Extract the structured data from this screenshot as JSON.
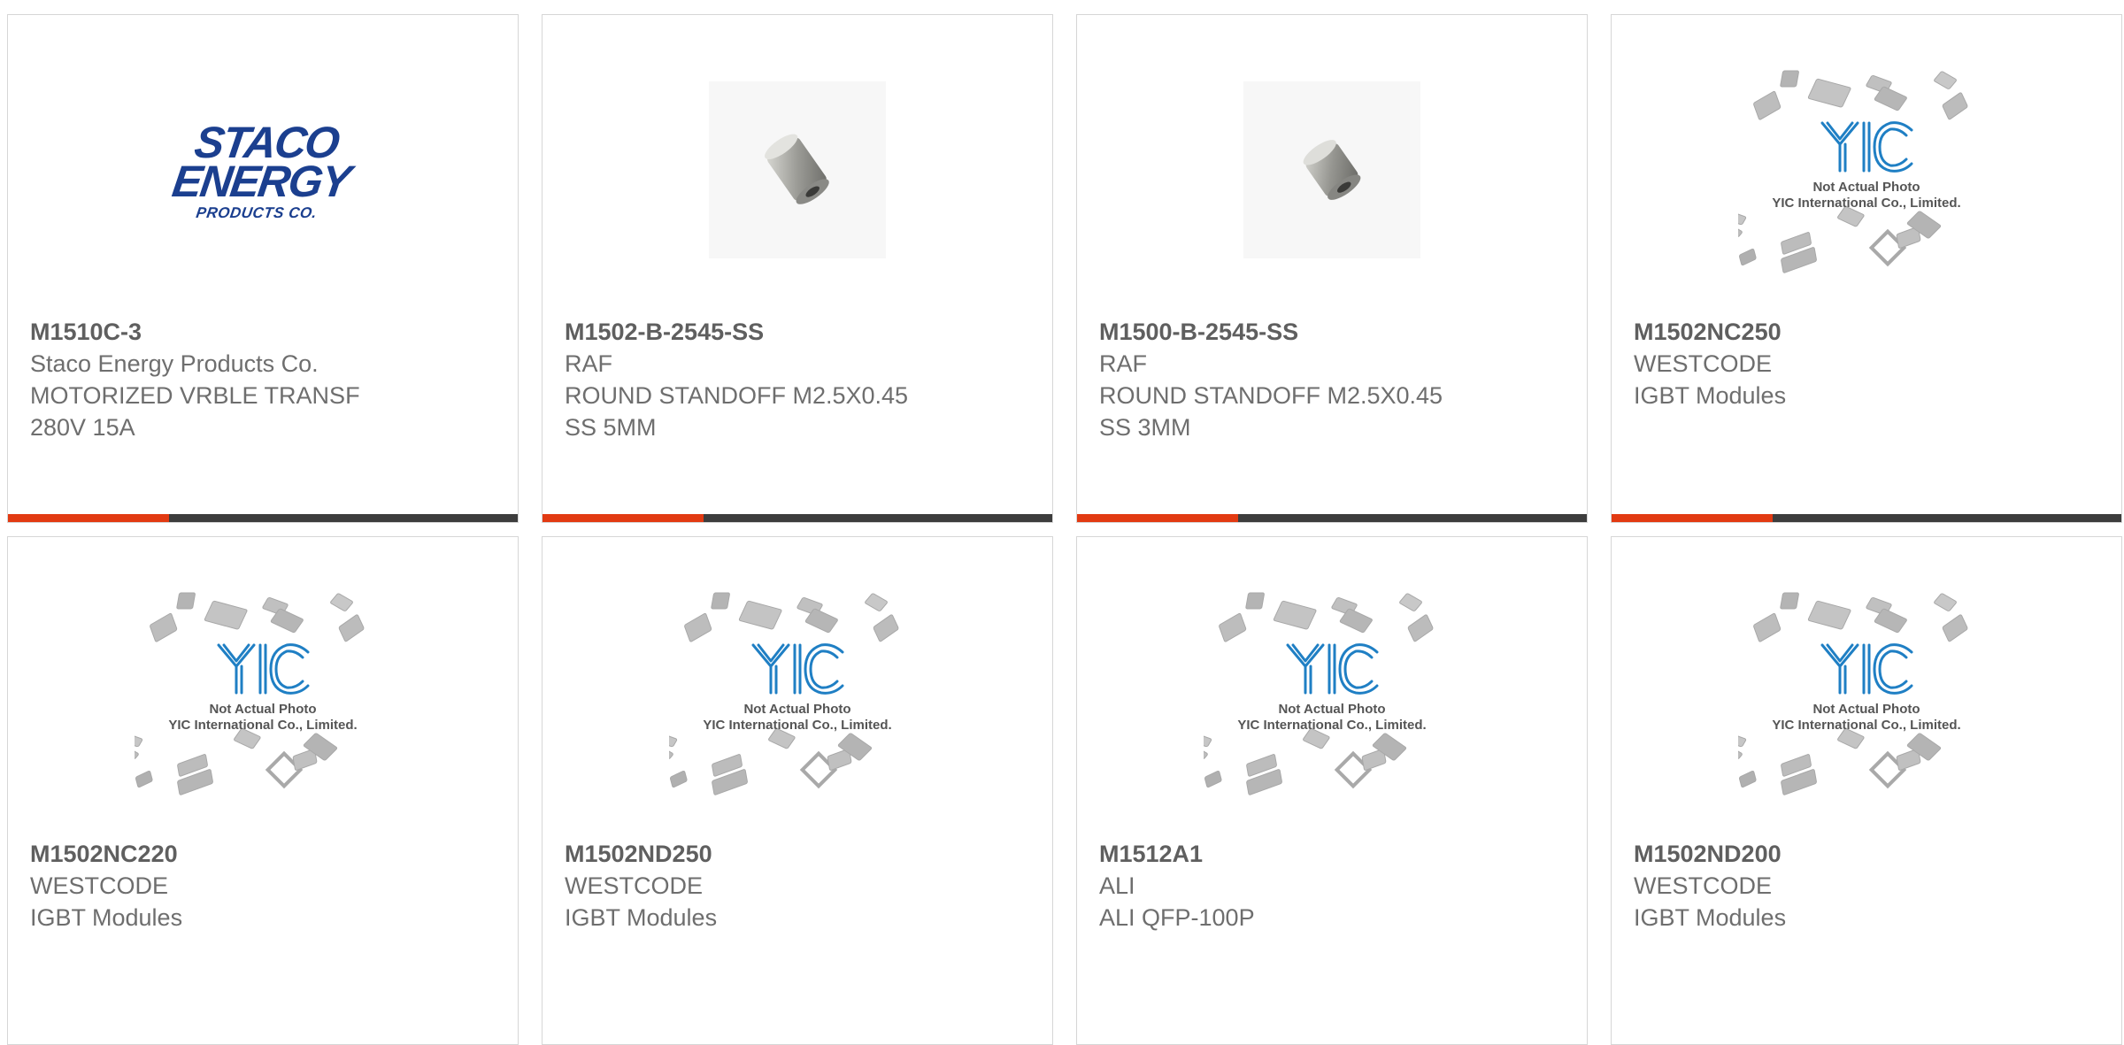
{
  "products": [
    {
      "part": "M1510C-3",
      "lines": [
        "Staco Energy Products Co.",
        "MOTORIZED VRBLE TRANSF",
        "280V 15A"
      ],
      "image": "staco-logo",
      "logo": {
        "w1": "STACO",
        "w2": "ENERGY",
        "w3": "PRODUCTS CO."
      }
    },
    {
      "part": "M1502-B-2545-SS",
      "lines": [
        "RAF",
        "ROUND STANDOFF M2.5X0.45",
        "SS 5MM"
      ],
      "image": "standoff-photo"
    },
    {
      "part": "M1500-B-2545-SS",
      "lines": [
        "RAF",
        "ROUND STANDOFF M2.5X0.45",
        "SS 3MM"
      ],
      "image": "standoff-photo"
    },
    {
      "part": "M1502NC250",
      "lines": [
        "WESTCODE",
        "IGBT Modules"
      ],
      "image": "yic-placeholder"
    },
    {
      "part": "M1502NC220",
      "lines": [
        "WESTCODE",
        "IGBT Modules"
      ],
      "image": "yic-placeholder"
    },
    {
      "part": "M1502ND250",
      "lines": [
        "WESTCODE",
        "IGBT Modules"
      ],
      "image": "yic-placeholder"
    },
    {
      "part": "M1512A1",
      "lines": [
        "ALI",
        "ALI QFP-100P"
      ],
      "image": "yic-placeholder"
    },
    {
      "part": "M1502ND200",
      "lines": [
        "WESTCODE",
        "IGBT Modules"
      ],
      "image": "yic-placeholder"
    }
  ],
  "placeholder": {
    "line1": "Not Actual Photo",
    "line2": "YIC International Co., Limited."
  },
  "colors": {
    "accent": "#e23a12",
    "bar": "#3d3d3d",
    "text": "#6e6e6e",
    "logo_blue": "#1b3f8f",
    "yic_blue": "#1f7fc4"
  }
}
